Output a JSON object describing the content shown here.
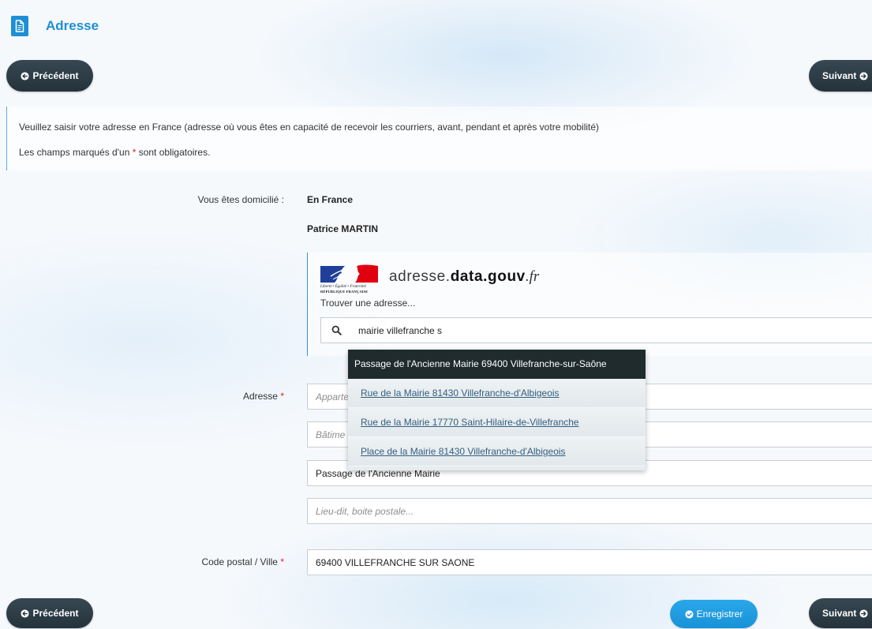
{
  "header": {
    "title": "Adresse",
    "icon": "document-icon"
  },
  "navigation": {
    "previous_label": "Précédent",
    "next_label": "Suivant",
    "save_label": "Enregistrer",
    "previous_icon": "circle-arrow-left-icon",
    "next_icon": "circle-arrow-right-icon",
    "save_icon": "check-circle-icon"
  },
  "info": {
    "intro": "Veuillez saisir votre adresse en France (adresse où vous êtes en capacité de recevoir les courriers, avant, pendant et après votre mobilité)",
    "required_before": "Les champs marqués d'un ",
    "required_mark": "*",
    "required_after": " sont obligatoires."
  },
  "form": {
    "domicile": {
      "label": "Vous êtes domicilié :",
      "value": "En France"
    },
    "holder_name": "Patrice MARTIN",
    "address_finder": {
      "logo": {
        "motto": "Liberté • Égalité • Fraternité",
        "name": "RÉPUBLIQUE FRANÇAISE"
      },
      "brand": {
        "prefix": "adresse.",
        "core": "data.gouv",
        "suffix": ".fr"
      },
      "prompt": "Trouver une adresse...",
      "search_icon": "search-icon",
      "query": "mairie villefranche s",
      "highlighted_index": 0,
      "suggestions": [
        "Passage de l'Ancienne Mairie 69400 Villefranche-sur-Saône",
        "Rue de la Mairie 81430 Villefranche-d'Albigeois",
        "Rue de la Mairie 17770 Saint-Hilaire-de-Villefranche",
        "Place de la Mairie 81430 Villefranche-d'Albigeois"
      ]
    },
    "address": {
      "label": "Adresse",
      "required_mark": "*",
      "line1_placeholder": "Apparte",
      "line2_placeholder": "Bâtime",
      "line3_value": "Passage de l'Ancienne Mairie",
      "line4_placeholder": "Lieu-dit, boite postale..."
    },
    "postal_city": {
      "label": "Code postal / Ville",
      "required_mark": "*",
      "value": "69400 VILLEFRANCHE SUR SAONE"
    }
  },
  "colors": {
    "accent": "#1e8fd5",
    "dark_button": "#2b3a44",
    "save_button": "#1e9be0",
    "required": "#e2231a",
    "highlight": "#1f2b2d",
    "link": "#355f80"
  }
}
